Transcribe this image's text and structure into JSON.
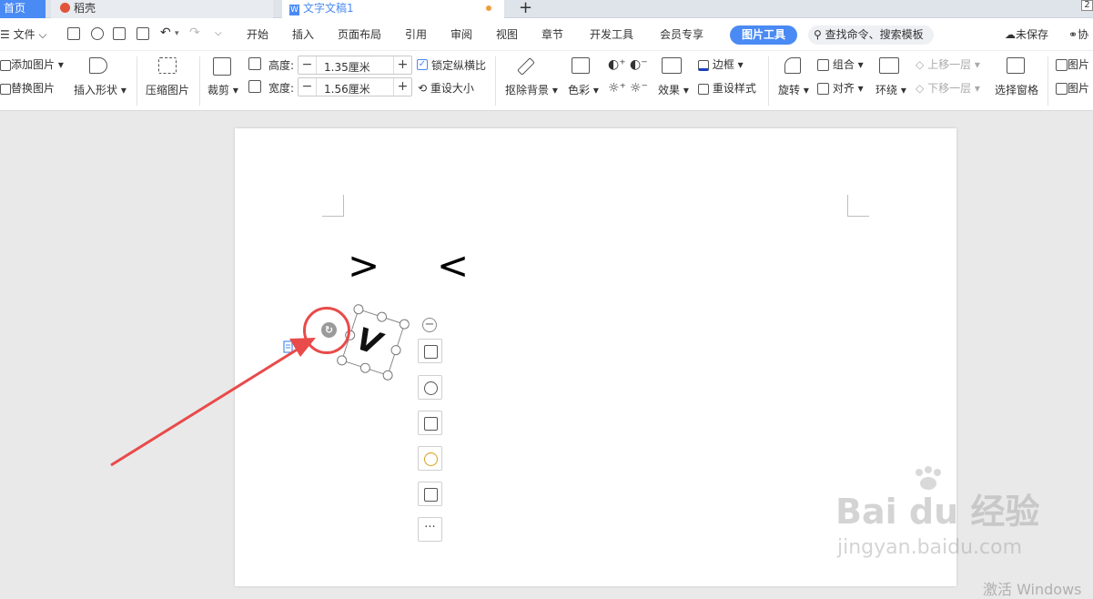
{
  "tabs": {
    "home": "首页",
    "daoke": "稻壳",
    "doc": "文字文稿1",
    "corner_num": "2"
  },
  "menu": {
    "file": "文件",
    "items": [
      "开始",
      "插入",
      "页面布局",
      "引用",
      "审阅",
      "视图",
      "章节",
      "开发工具",
      "会员专享"
    ],
    "active": "图片工具",
    "search": "查找命令、搜索模板",
    "unsaved": "未保存",
    "collab": "协"
  },
  "ribbon": {
    "add_image": "添加图片",
    "replace_image": "替换图片",
    "insert_shape": "插入形状",
    "compress": "压缩图片",
    "crop": "裁剪",
    "height_label": "高度:",
    "height_value": "1.35厘米",
    "width_label": "宽度:",
    "width_value": "1.56厘米",
    "lock_ratio": "锁定纵横比",
    "reset_size": "重设大小",
    "remove_bg": "抠除背景",
    "color": "色彩",
    "effects": "效果",
    "border": "边框",
    "reset_style": "重设样式",
    "rotate": "旋转",
    "group": "组合",
    "align": "对齐",
    "wrap": "环绕",
    "bring_forward": "上移一层",
    "send_backward": "下移一层",
    "selection_pane": "选择窗格",
    "img_more1": "图片",
    "img_more2": "图片"
  },
  "document": {
    "glyph_left": ">",
    "glyph_right": "<",
    "image_text": "V"
  },
  "float_toolbar": {
    "more": "···"
  },
  "watermark": {
    "main": "Bai du 经验",
    "sub": "jingyan.baidu.com"
  },
  "activate_text": "激活 Windows",
  "colors": {
    "accent": "#4a8af4",
    "annotation_red": "#e94a4a"
  }
}
